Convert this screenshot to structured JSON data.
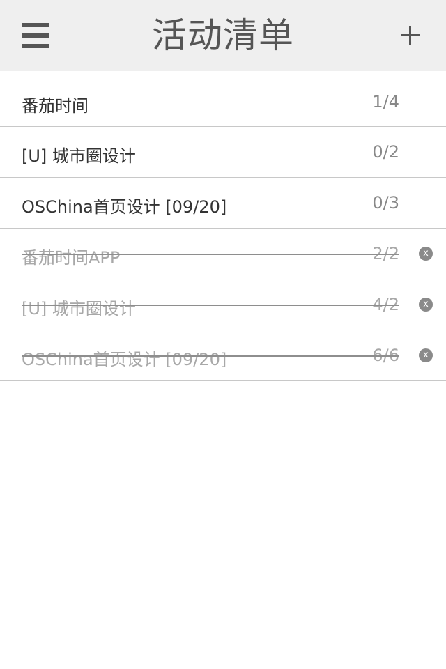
{
  "header": {
    "title": "活动清单",
    "menu_icon": "hamburger-menu-icon",
    "add_icon": "plus-icon"
  },
  "tasks": {
    "active": [
      {
        "name": "番茄时间",
        "count": "1/4"
      },
      {
        "name": "[U] 城市圈设计",
        "count": "0/2"
      },
      {
        "name": "OSChina首页设计 [09/20]",
        "count": "0/3"
      }
    ],
    "completed": [
      {
        "name": "番茄时间APP",
        "count": "2/2",
        "delete_glyph": "x"
      },
      {
        "name": "[U] 城市圈设计",
        "count": "4/2",
        "delete_glyph": "x"
      },
      {
        "name": "OSChina首页设计 [09/20]",
        "count": "6/6",
        "delete_glyph": "x"
      }
    ]
  },
  "colors": {
    "header_bg": "#efefef",
    "icon_gray": "#555555",
    "text_dark": "#333333",
    "text_muted": "#a8a8a8",
    "divider": "#c8c8c8"
  }
}
